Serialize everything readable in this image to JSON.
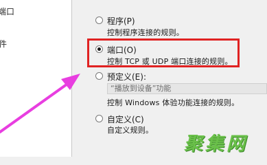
{
  "left_panel": {
    "items": [
      {
        "label": "端口",
        "selected": true
      },
      {
        "label": "件"
      }
    ]
  },
  "options": [
    {
      "label": "程序(P)",
      "description": "控制程序连接的规则。",
      "checked": false
    },
    {
      "label": "端口(O)",
      "description": "控制 TCP 或 UDP 端口连接的规则。",
      "checked": true
    },
    {
      "label": "预定义(E):",
      "dropdown_value": "“播放到设备”功能",
      "description": "控制 Windows 体验功能连接的规则。",
      "checked": false
    },
    {
      "label": "自定义(C)",
      "description": "自定义规则。",
      "checked": false
    }
  ],
  "annotation": {
    "highlight_color": "#e02222",
    "arrow_color": "#e83ee0"
  },
  "watermark": {
    "text": "聚集网"
  }
}
